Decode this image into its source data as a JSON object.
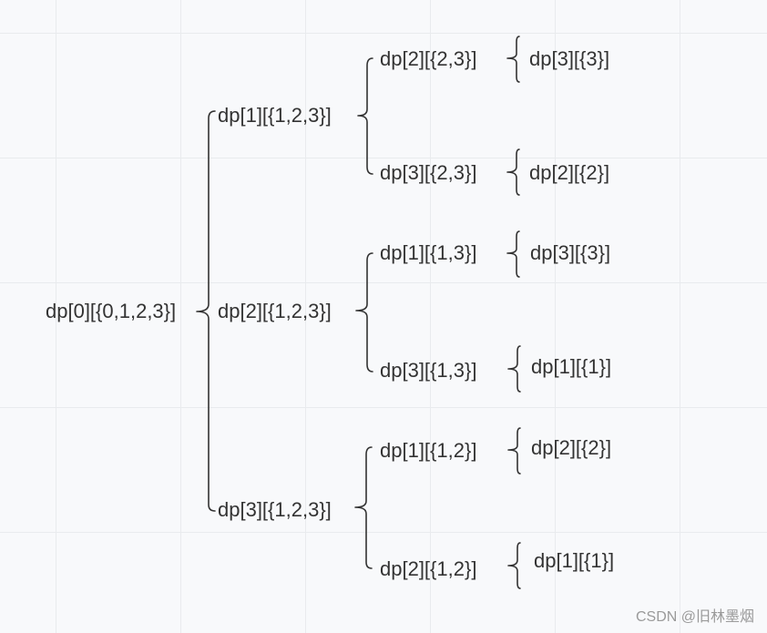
{
  "nodes": {
    "root": "dp[0][{0,1,2,3}]",
    "l1_a": "dp[1][{1,2,3}]",
    "l1_b": "dp[2][{1,2,3}]",
    "l1_c": "dp[3][{1,2,3}]",
    "l2_a1": "dp[2][{2,3}]",
    "l2_a2": "dp[3][{2,3}]",
    "l2_b1": "dp[1][{1,3}]",
    "l2_b2": "dp[3][{1,3}]",
    "l2_c1": "dp[1][{1,2}]",
    "l2_c2": "dp[2][{1,2}]",
    "l3_a1": "dp[3][{3}]",
    "l3_a2": "dp[2][{2}]",
    "l3_b1": "dp[3][{3}]",
    "l3_b2": "dp[1][{1}]",
    "l3_c1": "dp[2][{2}]",
    "l3_c2": "dp[1][{1}]"
  },
  "watermark": "CSDN @旧林墨烟"
}
